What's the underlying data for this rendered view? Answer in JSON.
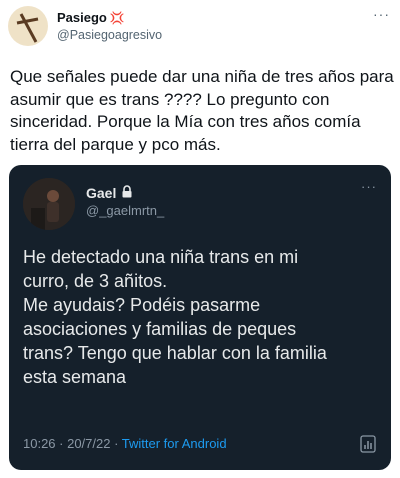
{
  "outer_tweet": {
    "display_name": "Pasiego",
    "name_emoji": "💢",
    "handle": "@Pasiegoagresivo",
    "more": "···",
    "text": "Que señales puede dar una niña de tres años para asumir que es trans ???? Lo pregunto con sinceridad. Porque la Mía con tres años comía tierra del parque y pco más."
  },
  "quoted_tweet": {
    "display_name": "Gael",
    "handle": "@_gaelmrtn_",
    "more": "···",
    "text_lines": [
      "He detectado una niña trans en mi",
      "curro, de 3 añitos.",
      "Me ayudais? Podéis pasarme",
      "asociaciones y familias de peques",
      "trans? Tengo que hablar con la familia",
      "esta semana"
    ],
    "time": "10:26 · 20/7/22 · ",
    "source": "Twitter for Android"
  },
  "colors": {
    "quote_background": "#15202b",
    "link_blue": "#1d9bf0",
    "text_dark": "#0f1419",
    "text_muted": "#536471"
  },
  "icons": [
    "cross-avatar-icon",
    "anger-emoji-icon",
    "more-icon",
    "lock-icon",
    "analytics-icon"
  ]
}
